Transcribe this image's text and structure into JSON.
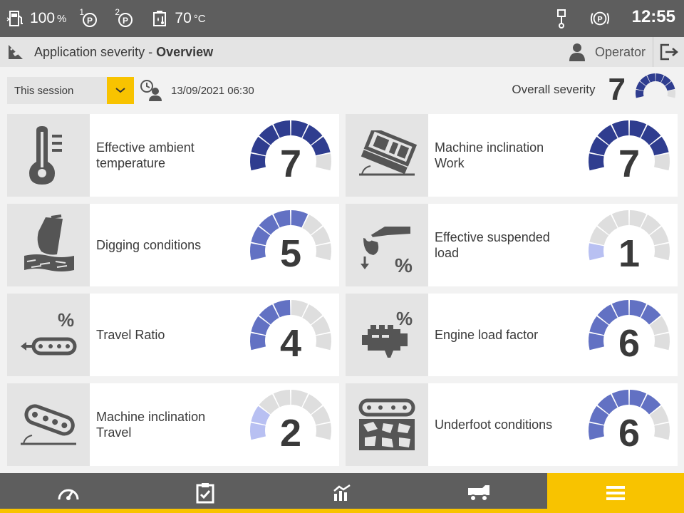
{
  "status_bar": {
    "fuel_value": "100",
    "fuel_unit": "%",
    "pump1_label": "1",
    "pump2_label": "2",
    "temp_value": "70",
    "temp_unit": "°C",
    "time": "12:55",
    "icons": [
      "fuel-icon",
      "pump-pressure-1-icon",
      "pump-pressure-2-icon",
      "hydraulic-oil-icon",
      "engine-piston-icon",
      "parking-brake-icon"
    ]
  },
  "header": {
    "title_prefix": "Application severity - ",
    "title_bold": "Overview",
    "operator_label": "Operator"
  },
  "filters": {
    "period_selected": "This session",
    "date": "13/09/2021 06:30"
  },
  "overall": {
    "label": "Overall severity",
    "value": "7",
    "level": 7
  },
  "severity_max": 8,
  "colors": {
    "dark_blue": "#2f3d8f",
    "medium_blue": "#6271c3",
    "light_blue": "#b8c0f2",
    "inactive": "#dedede",
    "accent": "#f8c300",
    "bar": "#5e5e5e"
  },
  "tiles": [
    {
      "label_line1": "Effective ambient",
      "label_line2": "temperature",
      "value": "7",
      "level": 7,
      "color": "#2f3d8f",
      "icon": "thermometer-icon"
    },
    {
      "label_line1": "Machine inclination",
      "label_line2": "Work",
      "value": "7",
      "level": 7,
      "color": "#2f3d8f",
      "icon": "machine-inclination-work-icon"
    },
    {
      "label_line1": "Digging conditions",
      "label_line2": "",
      "value": "5",
      "level": 5,
      "color": "#6271c3",
      "icon": "digging-bucket-icon"
    },
    {
      "label_line1": "Effective suspended",
      "label_line2": "load",
      "value": "1",
      "level": 1,
      "color": "#b8c0f2",
      "icon": "suspended-load-icon"
    },
    {
      "label_line1": "Travel Ratio",
      "label_line2": "",
      "value": "4",
      "level": 4,
      "color": "#6271c3",
      "icon": "travel-ratio-icon"
    },
    {
      "label_line1": "Engine load factor",
      "label_line2": "",
      "value": "6",
      "level": 6,
      "color": "#6271c3",
      "icon": "engine-load-icon"
    },
    {
      "label_line1": "Machine inclination",
      "label_line2": "Travel",
      "value": "2",
      "level": 2,
      "color": "#b8c0f2",
      "icon": "machine-inclination-travel-icon"
    },
    {
      "label_line1": "Underfoot conditions",
      "label_line2": "",
      "value": "6",
      "level": 6,
      "color": "#6271c3",
      "icon": "underfoot-conditions-icon"
    }
  ],
  "nav": {
    "items": [
      "dashboard-gauge-icon",
      "checklist-icon",
      "statistics-chart-icon",
      "haul-truck-icon",
      "menu-icon"
    ],
    "active_index": 4
  }
}
